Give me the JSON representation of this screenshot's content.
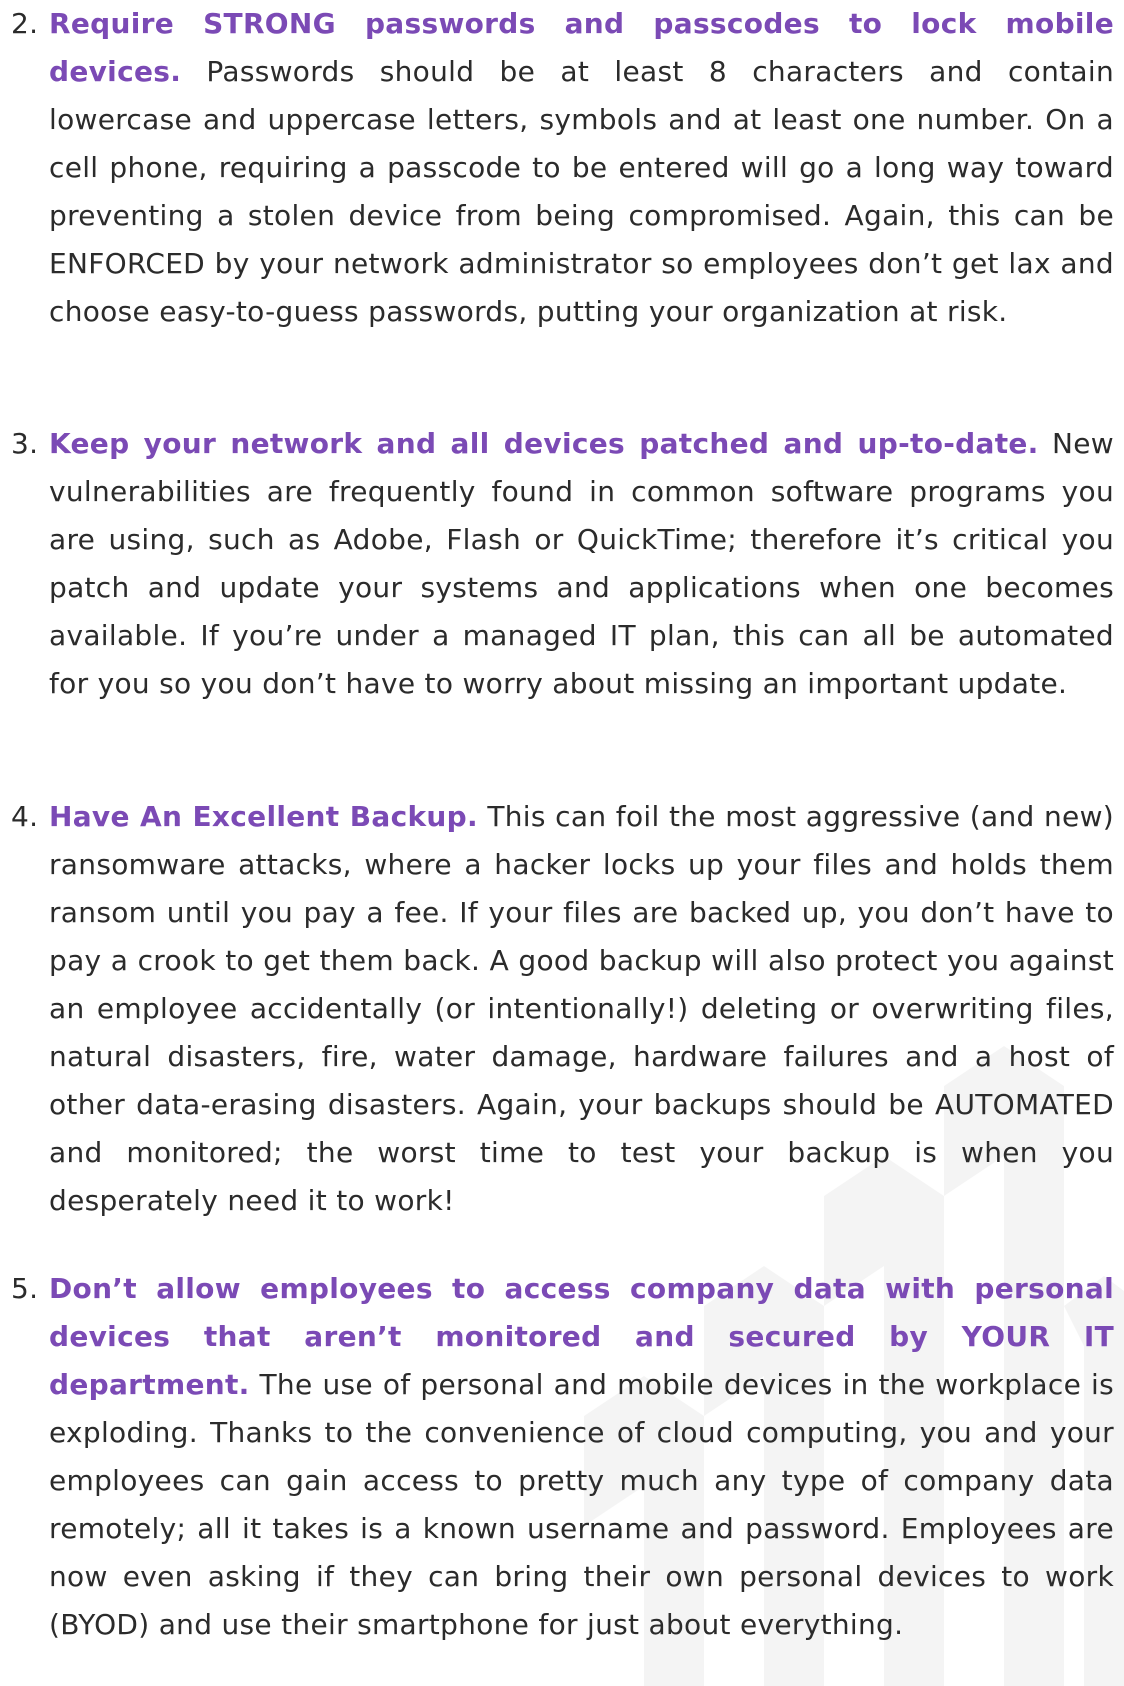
{
  "items": [
    {
      "number": "2.",
      "heading": "Require STRONG passwords and passcodes to lock mobile devices.",
      "body": " Passwords should be at least 8 characters and contain lowercase and uppercase letters, symbols and at least one number. On a cell phone, requiring a passcode to be entered will go a long way toward preventing a stolen device from being compromised. Again, this can be ENFORCED by your network administrator so employees don’t get lax and choose easy-to-guess passwords, putting your organization at risk."
    },
    {
      "number": "3.",
      "heading": "Keep your network and all devices patched and up-to-date.",
      "body": " New vulnerabilities are frequently found in common software programs you are using, such as Adobe, Flash or QuickTime; therefore it’s critical you patch and update your systems and applications when one becomes available. If you’re under a managed IT plan, this can all be automated for you so you don’t have to worry about missing an important update."
    },
    {
      "number": "4.",
      "heading": "Have An Excellent Backup.",
      "body": " This can foil the most aggressive (and new) ransomware attacks, where a hacker locks up your files and holds them ransom until you pay a fee. If your files are backed up, you don’t have to pay a crook to get them back. A good backup will also protect you against an employee accidentally (or intentionally!) deleting or overwriting files, natural disasters, fire, water damage, hardware failures and a host of other data-erasing disasters. Again, your backups should be AUTOMATED and monitored; the worst time to test your backup is when you desperately need it to work!"
    },
    {
      "number": "5.",
      "heading": "Don’t allow employees to access company data with personal devices that aren’t monitored and secured by YOUR IT department.",
      "body": " The use of personal and mobile devices in the workplace is exploding. Thanks to the convenience of cloud computing, you and your employees can gain access to pretty much any type of company data remotely; all it takes is a known username and password.  Employees are now even asking if they can bring their own personal devices to work (BYOD) and use their smartphone for just about everything."
    }
  ],
  "colors": {
    "heading": "#7b4ab5",
    "body_text": "#2b2b2b",
    "watermark": "#3a3a3a"
  }
}
